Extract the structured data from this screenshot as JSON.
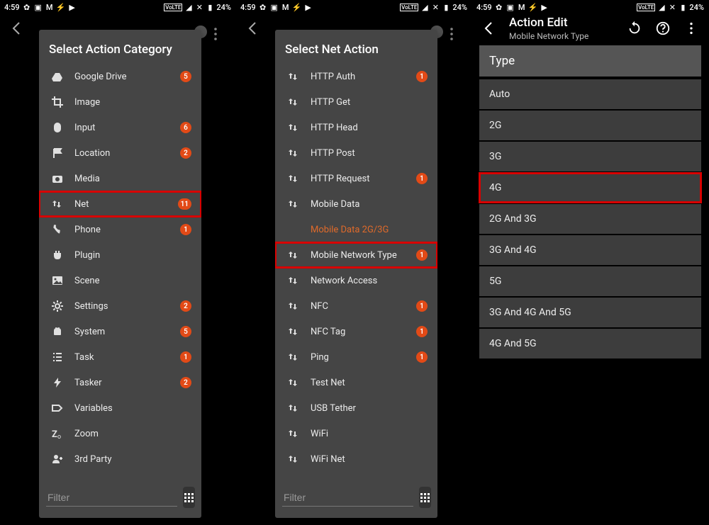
{
  "status": {
    "time": "4:59",
    "battery": "24%",
    "indicator": "VoLTE"
  },
  "screen1": {
    "panel_title": "Select Action Category",
    "items": [
      {
        "icon": "google-drive",
        "label": "Google Drive",
        "badge": "5"
      },
      {
        "icon": "crop",
        "label": "Image",
        "badge": ""
      },
      {
        "icon": "mouse",
        "label": "Input",
        "badge": "6"
      },
      {
        "icon": "flag",
        "label": "Location",
        "badge": "2"
      },
      {
        "icon": "camera",
        "label": "Media",
        "badge": ""
      },
      {
        "icon": "swap",
        "label": "Net",
        "badge": "11",
        "highlighted": true
      },
      {
        "icon": "phone",
        "label": "Phone",
        "badge": "1"
      },
      {
        "icon": "plug",
        "label": "Plugin",
        "badge": ""
      },
      {
        "icon": "image",
        "label": "Scene",
        "badge": ""
      },
      {
        "icon": "gear",
        "label": "Settings",
        "badge": "2"
      },
      {
        "icon": "android",
        "label": "System",
        "badge": "5"
      },
      {
        "icon": "list",
        "label": "Task",
        "badge": "1"
      },
      {
        "icon": "bolt",
        "label": "Tasker",
        "badge": "2"
      },
      {
        "icon": "label",
        "label": "Variables",
        "badge": ""
      },
      {
        "icon": "zoom",
        "label": "Zoom",
        "badge": ""
      },
      {
        "icon": "people",
        "label": "3rd Party",
        "badge": ""
      }
    ],
    "filter_placeholder": "Filter"
  },
  "screen2": {
    "panel_title": "Select Net Action",
    "items": [
      {
        "icon": "swap",
        "label": "HTTP Auth",
        "badge": "1"
      },
      {
        "icon": "swap",
        "label": "HTTP Get",
        "badge": ""
      },
      {
        "icon": "swap",
        "label": "HTTP Head",
        "badge": ""
      },
      {
        "icon": "swap",
        "label": "HTTP Post",
        "badge": ""
      },
      {
        "icon": "swap",
        "label": "HTTP Request",
        "badge": "1"
      },
      {
        "icon": "swap",
        "label": "Mobile Data",
        "badge": ""
      },
      {
        "icon": "",
        "label": "Mobile Data 2G/3G",
        "badge": "",
        "disabled": true
      },
      {
        "icon": "swap",
        "label": "Mobile Network Type",
        "badge": "1",
        "highlighted": true
      },
      {
        "icon": "swap",
        "label": "Network Access",
        "badge": ""
      },
      {
        "icon": "swap",
        "label": "NFC",
        "badge": "1"
      },
      {
        "icon": "swap",
        "label": "NFC Tag",
        "badge": "1"
      },
      {
        "icon": "swap",
        "label": "Ping",
        "badge": "1"
      },
      {
        "icon": "swap",
        "label": "Test Net",
        "badge": ""
      },
      {
        "icon": "swap",
        "label": "USB Tether",
        "badge": ""
      },
      {
        "icon": "swap",
        "label": "WiFi",
        "badge": ""
      },
      {
        "icon": "swap",
        "label": "WiFi Net",
        "badge": ""
      }
    ],
    "filter_placeholder": "Filter"
  },
  "screen3": {
    "title": "Action Edit",
    "subtitle": "Mobile Network Type",
    "section_header": "Type",
    "options": [
      {
        "label": "Auto"
      },
      {
        "label": "2G"
      },
      {
        "label": "3G"
      },
      {
        "label": "4G",
        "highlighted": true
      },
      {
        "label": "2G And 3G"
      },
      {
        "label": "3G And 4G"
      },
      {
        "label": "5G"
      },
      {
        "label": "3G And 4G And 5G"
      },
      {
        "label": "4G And 5G"
      }
    ]
  }
}
